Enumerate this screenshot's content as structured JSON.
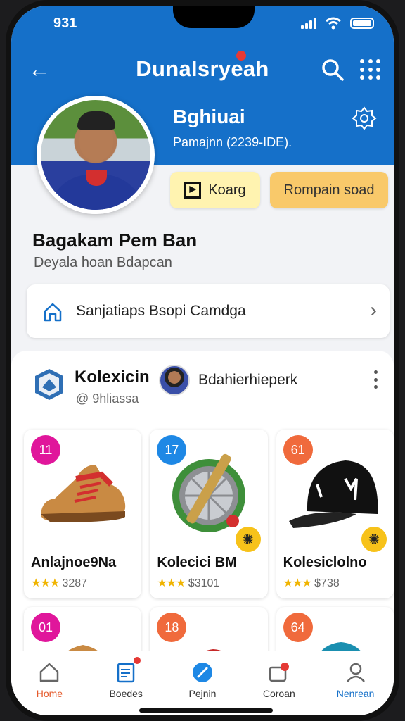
{
  "status": {
    "time": "931"
  },
  "header": {
    "title": "Dunalsryeah"
  },
  "profile": {
    "name": "Bghiuai",
    "subtitle": "Pamajnn (2239-IDE).",
    "btn_secondary": "Koarg",
    "btn_primary": "Rompain soad"
  },
  "section": {
    "title": "Bagakam Pem Ban",
    "subtitle": "Deyala hoan Bdapcan"
  },
  "info_card": {
    "label": "Sanjatiaps Bsopi Camdga"
  },
  "collection": {
    "title": "Kolexicin",
    "handle": "@ 9hliassa",
    "follower_name": "Bdahierhieperk",
    "items": [
      {
        "num": "11",
        "num_color": "#e0169b",
        "name": "Anlajnoe9Na",
        "rating": "★★★",
        "price": "3287",
        "art": "shoe-icon"
      },
      {
        "num": "17",
        "num_color": "#1e88e5",
        "name": "Kolecici BM",
        "rating": "★★★",
        "price": "$3101",
        "art": "medal-icon"
      },
      {
        "num": "61",
        "num_color": "#f06a3c",
        "name": "Kolesiclolno",
        "rating": "★★★",
        "price": "$738",
        "art": "cap-icon"
      }
    ],
    "items_row2": [
      {
        "num": "01",
        "num_color": "#e0169b",
        "art": "glove-icon"
      },
      {
        "num": "18",
        "num_color": "#f06a3c",
        "art": "boot-icon"
      },
      {
        "num": "64",
        "num_color": "#f06a3c",
        "art": "backpack-icon"
      }
    ]
  },
  "tabs": [
    {
      "label": "Home",
      "icon": "home-icon"
    },
    {
      "label": "Boedes",
      "icon": "document-icon"
    },
    {
      "label": "Pejnin",
      "icon": "compass-icon"
    },
    {
      "label": "Coroan",
      "icon": "camera-icon"
    },
    {
      "label": "Nenrean",
      "icon": "profile-icon"
    }
  ],
  "colors": {
    "primary": "#1570c9",
    "accent_orange": "#f9c96a",
    "accent_yellow": "#fff3b0"
  }
}
